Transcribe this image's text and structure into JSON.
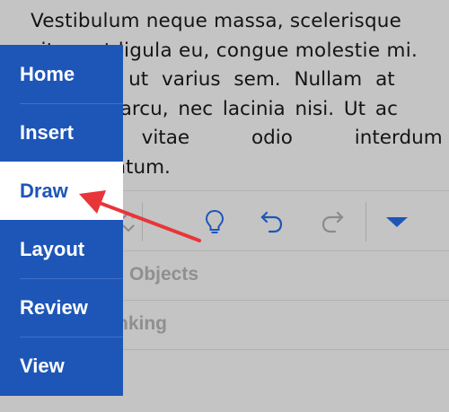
{
  "document": {
    "lines": [
      "Vestibulum neque massa, scelerisque",
      "sit amet ligula eu, congue molestie mi.",
      "Praesent ut varius sem. Nullam at",
      "porttitor arcu, nec lacinia nisi. Ut ac",
      "dolor vitae odio interdum",
      "condimentum."
    ]
  },
  "toolbar": {
    "icons": [
      "sort-arrows-icon",
      "lightbulb-icon",
      "undo-icon",
      "redo-icon",
      "dropdown-triangle-icon"
    ]
  },
  "menu": {
    "rows": [
      {
        "label": "Objects"
      },
      {
        "label": "nking"
      }
    ]
  },
  "tabs": {
    "items": [
      {
        "label": "Home"
      },
      {
        "label": "Insert"
      },
      {
        "label": "Draw"
      },
      {
        "label": "Layout"
      },
      {
        "label": "Review"
      },
      {
        "label": "View"
      }
    ],
    "active": "Draw"
  },
  "colors": {
    "tab_panel": "#1e56b8",
    "annotation_arrow": "#e8353a"
  }
}
